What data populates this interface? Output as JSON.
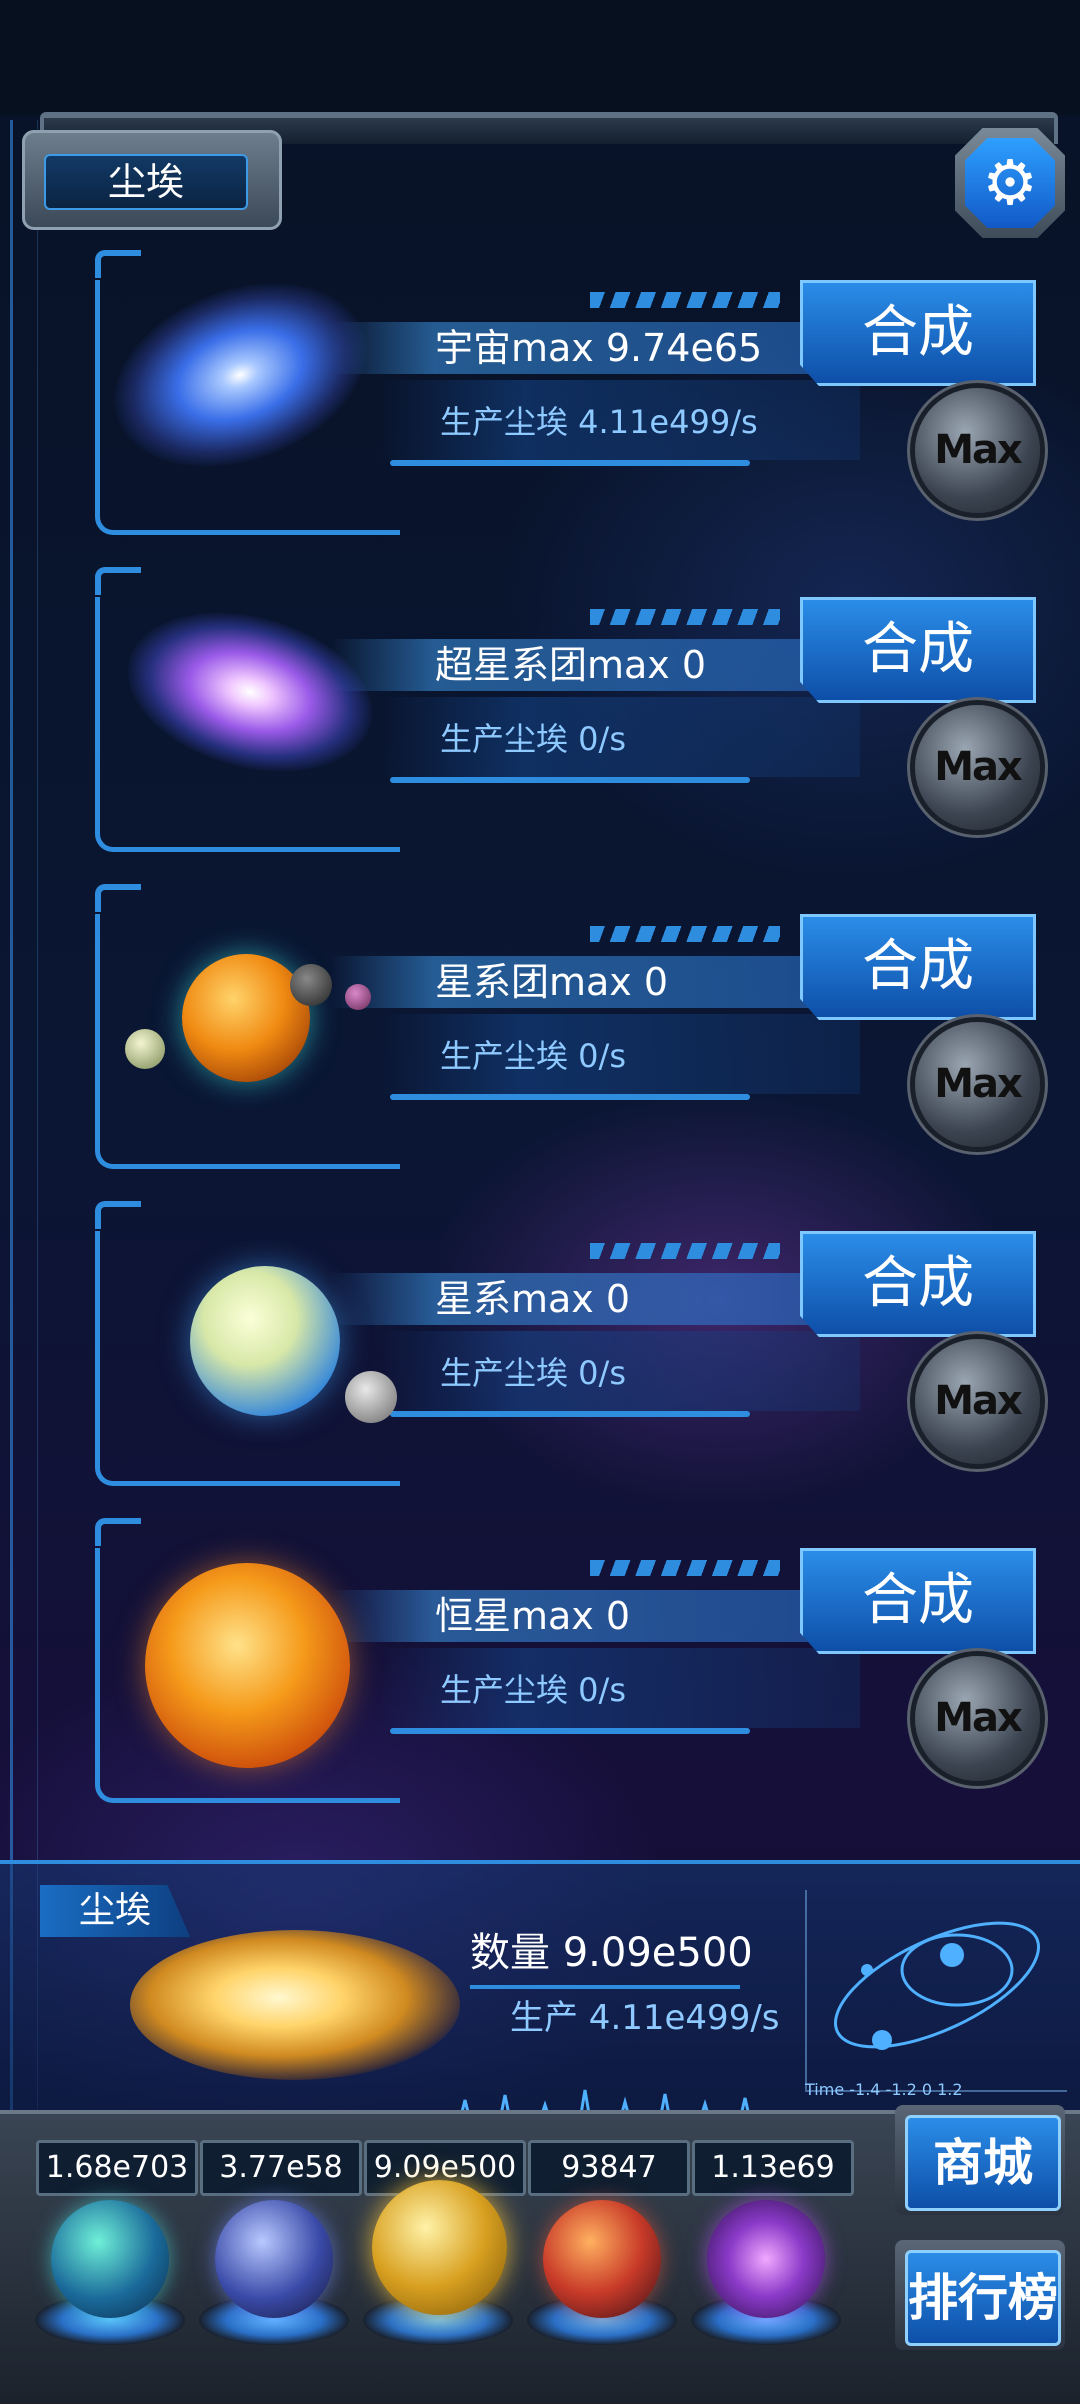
{
  "header": {
    "section_tab": "尘埃",
    "settings_icon": "gear-icon",
    "settings_glyph": "⚙"
  },
  "items": [
    {
      "name": "宇宙max 9.74e65",
      "production": "生产尘埃  4.11e499/s",
      "synth_label": "合成",
      "max_label": "Max"
    },
    {
      "name": "超星系团max 0",
      "production": "生产尘埃  0/s",
      "synth_label": "合成",
      "max_label": "Max"
    },
    {
      "name": "星系团max 0",
      "production": "生产尘埃  0/s",
      "synth_label": "合成",
      "max_label": "Max"
    },
    {
      "name": "星系max 0",
      "production": "生产尘埃  0/s",
      "synth_label": "合成",
      "max_label": "Max"
    },
    {
      "name": "恒星max 0",
      "production": "生产尘埃  0/s",
      "synth_label": "合成",
      "max_label": "Max"
    }
  ],
  "summary": {
    "label": "尘埃",
    "amount": "数量 9.09e500",
    "rate": "生产 4.11e499/s",
    "graph_axis": "Time -1.4 -1.2  0   1.2"
  },
  "resources": [
    {
      "value": "1.68e703",
      "icon": "atom-orb-icon"
    },
    {
      "value": "3.77e58",
      "icon": "lightning-orb-icon"
    },
    {
      "value": "9.09e500",
      "icon": "dust-orb-icon"
    },
    {
      "value": "93847",
      "icon": "brain-orb-icon"
    },
    {
      "value": "1.13e69",
      "icon": "portal-orb-icon"
    }
  ],
  "side_buttons": {
    "shop": "商城",
    "ranking": "排行榜"
  },
  "colors": {
    "accent": "#2f8de0",
    "button": "#1a6fd0",
    "text_secondary": "#8ec9ff"
  }
}
